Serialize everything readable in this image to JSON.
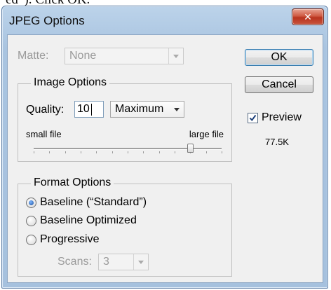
{
  "background_fragment": "ed”). Click OK.",
  "window": {
    "title": "JPEG Options",
    "close_glyph": "✕"
  },
  "matte": {
    "label": "Matte:",
    "value": "None"
  },
  "image_options": {
    "legend": "Image Options",
    "quality_label": "Quality:",
    "quality_value": "10",
    "quality_preset": "Maximum",
    "small_label": "small file",
    "large_label": "large file",
    "quality_level": 10,
    "quality_max": 12
  },
  "format_options": {
    "legend": "Format Options",
    "radios": [
      {
        "label": "Baseline (“Standard”)",
        "selected": true
      },
      {
        "label": "Baseline Optimized",
        "selected": false
      },
      {
        "label": "Progressive",
        "selected": false
      }
    ],
    "scans_label": "Scans:",
    "scans_value": "3"
  },
  "buttons": {
    "ok": "OK",
    "cancel": "Cancel"
  },
  "preview": {
    "label": "Preview",
    "checked": true,
    "size": "77.5K"
  },
  "colors": {
    "title_bar": "#a9c4e0",
    "client_bg": "#f0f0f0",
    "close_red": "#c8553e",
    "radio_dot": "#1a4f9c"
  }
}
